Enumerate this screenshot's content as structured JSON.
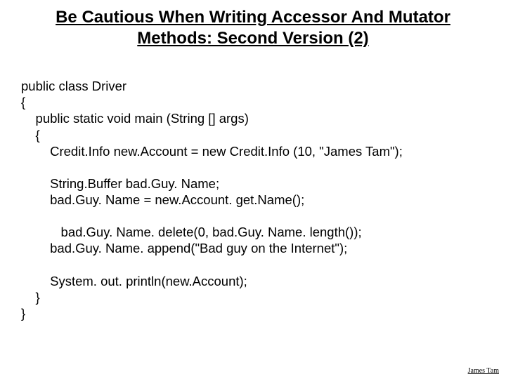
{
  "title": "Be Cautious When Writing Accessor And Mutator Methods: Second Version (2)",
  "code": {
    "l1": "public class Driver",
    "l2": "{",
    "l3": "    public static void main (String [] args)",
    "l4": "    {",
    "l5": "        Credit.Info new.Account = new Credit.Info (10, \"James Tam\");",
    "l6": "",
    "l7": "        String.Buffer bad.Guy. Name;",
    "l8": "        bad.Guy. Name = new.Account. get.Name();",
    "l9": "",
    "l10": "           bad.Guy. Name. delete(0, bad.Guy. Name. length());",
    "l11": "        bad.Guy. Name. append(\"Bad guy on the Internet\");",
    "l12": "",
    "l13": "        System. out. println(new.Account);",
    "l14": "    }",
    "l15": "}"
  },
  "footer": "James Tam"
}
